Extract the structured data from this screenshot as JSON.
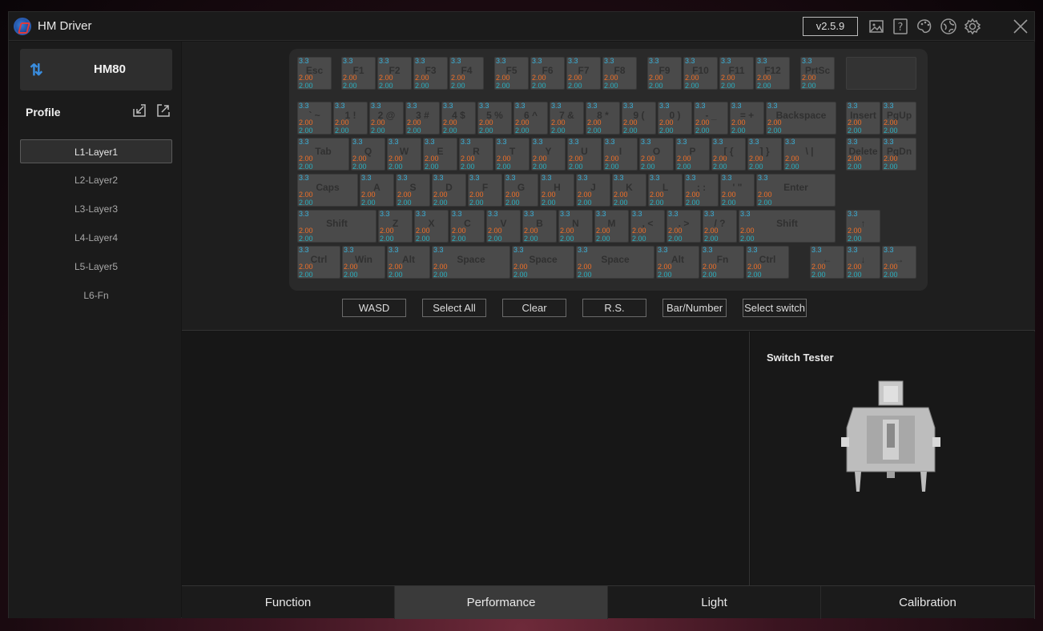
{
  "app": {
    "title": "HM Driver",
    "version": "v2.5.9",
    "icons": [
      "image-icon",
      "help-icon",
      "palette-icon",
      "globe-icon",
      "gear-icon",
      "close-icon"
    ]
  },
  "sidebar": {
    "device": "HM80",
    "profile_label": "Profile",
    "layers": [
      "L1-Layer1",
      "L2-Layer2",
      "L3-Layer3",
      "L4-Layer4",
      "L5-Layer5",
      "L6-Fn"
    ],
    "active_layer": 0
  },
  "keyboard": {
    "value_actuation": "3.3",
    "value_press": "2.00",
    "value_release": "2.00",
    "rows": [
      [
        "Esc",
        "F1",
        "F2",
        "F3",
        "F4",
        "F5",
        "F6",
        "F7",
        "F8",
        "F9",
        "F10",
        "F11",
        "F12",
        "PrtSc"
      ],
      [
        "` ~",
        "1 !",
        "2 @",
        "3 #",
        "4 $",
        "5 %",
        "6 ^",
        "7 &",
        "8 *",
        "9 (",
        "0 )",
        "- _",
        "= +",
        "Backspace",
        "Insert",
        "PgUp"
      ],
      [
        "Tab",
        "Q",
        "W",
        "E",
        "R",
        "T",
        "Y",
        "U",
        "I",
        "O",
        "P",
        "[ {",
        "] }",
        "\\ |",
        "Delete",
        "PgDn"
      ],
      [
        "Caps",
        "A",
        "S",
        "D",
        "F",
        "G",
        "H",
        "J",
        "K",
        "L",
        "; :",
        "' \"",
        "Enter"
      ],
      [
        "Shift",
        "Z",
        "X",
        "C",
        "V",
        "B",
        "N",
        "M",
        ", <",
        ". >",
        "/ ?",
        "Shift",
        "↑"
      ],
      [
        "Ctrl",
        "Win",
        "Alt",
        "Space",
        "Space",
        "Space",
        "Alt",
        "Fn",
        "Ctrl",
        "←",
        "↓",
        "→"
      ]
    ]
  },
  "actions": [
    "WASD",
    "Select All",
    "Clear",
    "R.S.",
    "Bar/Number",
    "Select switch"
  ],
  "switch_tester": {
    "title": "Switch Tester"
  },
  "tabs": [
    "Function",
    "Performance",
    "Light",
    "Calibration"
  ],
  "active_tab": 1,
  "colors": {
    "actuation": "#3ab0d8",
    "press": "#f07028",
    "release": "#2ab0c0",
    "accent": "#3a8ee0"
  }
}
